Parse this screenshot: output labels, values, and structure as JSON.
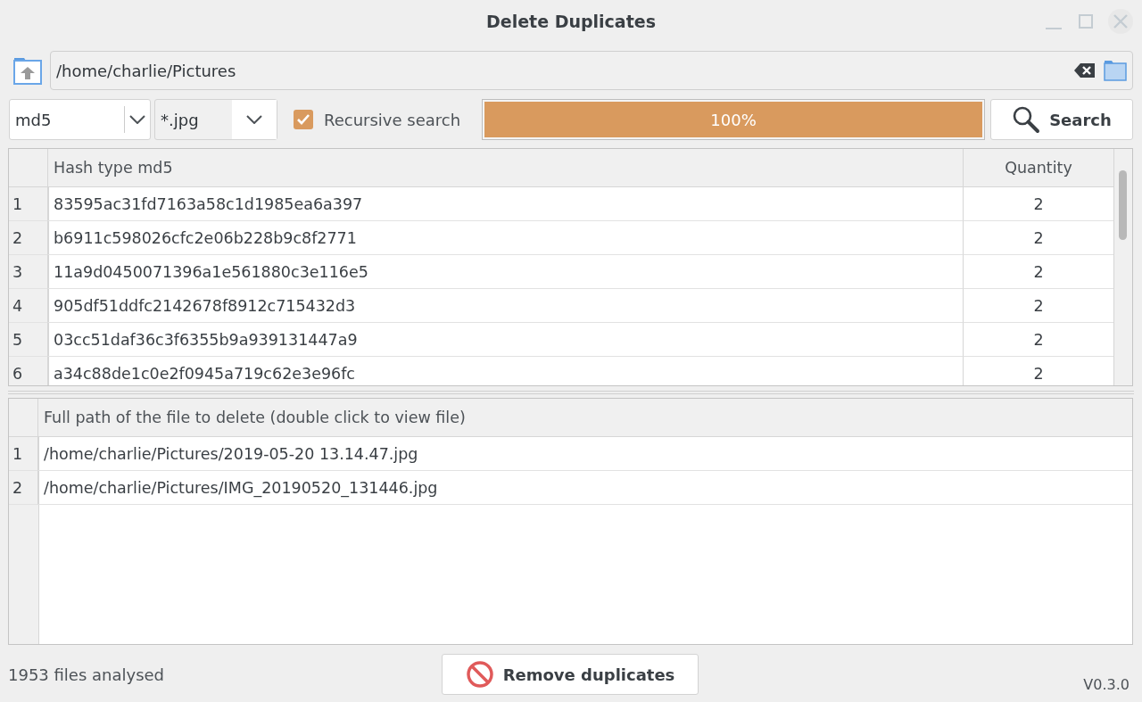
{
  "window": {
    "title": "Delete Duplicates"
  },
  "path_field": {
    "value": "/home/charlie/Pictures"
  },
  "hash_select": {
    "value": "md5"
  },
  "filter_select": {
    "value": "*.jpg"
  },
  "recursive": {
    "label": "Recursive search",
    "checked": true
  },
  "progress": {
    "level": 1,
    "text": "100%"
  },
  "search_button": {
    "label": "Search"
  },
  "hash_table": {
    "columns": [
      "Hash type md5",
      "Quantity"
    ],
    "rows": [
      {
        "index": "1",
        "hash": "83595ac31fd7163a58c1d1985ea6a397",
        "quantity": "2"
      },
      {
        "index": "2",
        "hash": "b6911c598026cfc2e06b228b9c8f2771",
        "quantity": "2"
      },
      {
        "index": "3",
        "hash": "11a9d0450071396a1e561880c3e116e5",
        "quantity": "2"
      },
      {
        "index": "4",
        "hash": "905df51ddfc2142678f8912c715432d3",
        "quantity": "2"
      },
      {
        "index": "5",
        "hash": "03cc51daf36c3f6355b9a939131447a9",
        "quantity": "2"
      },
      {
        "index": "6",
        "hash": "a34c88de1c0e2f0945a719c62e3e96fc",
        "quantity": "2"
      }
    ]
  },
  "file_table": {
    "columns": [
      "Full path of the file to delete (double click to view file)"
    ],
    "rows": [
      {
        "index": "1",
        "path": "/home/charlie/Pictures/2019-05-20 13.14.47.jpg"
      },
      {
        "index": "2",
        "path": "/home/charlie/Pictures/IMG_20190520_131446.jpg"
      }
    ]
  },
  "status": "1953 files analysed",
  "remove_button": {
    "label": "Remove duplicates"
  },
  "version": "V0.3.0"
}
